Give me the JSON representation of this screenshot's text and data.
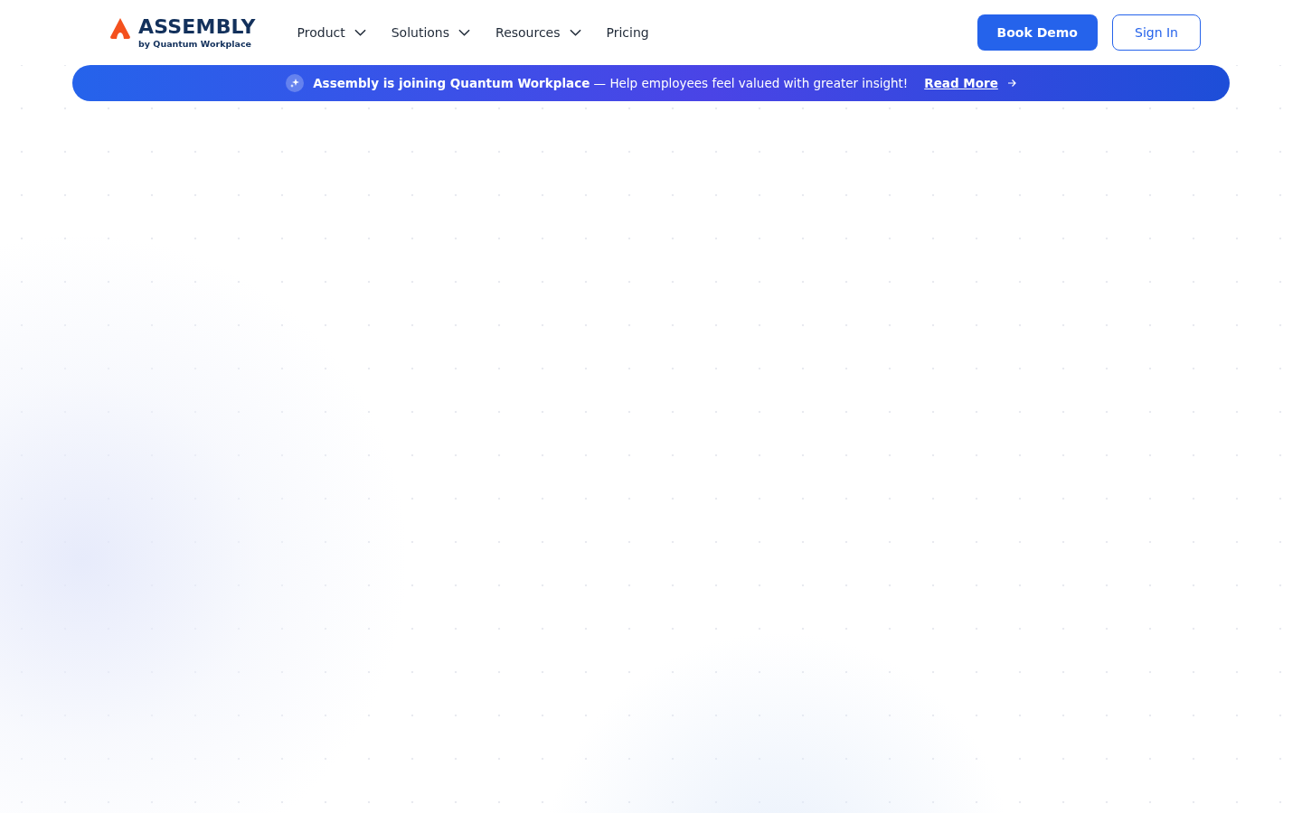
{
  "logo": {
    "name": "ASSEMBLY",
    "byline": "by Quantum Workplace"
  },
  "nav": [
    {
      "label": "Product",
      "has_menu": true
    },
    {
      "label": "Solutions",
      "has_menu": true
    },
    {
      "label": "Resources",
      "has_menu": true
    },
    {
      "label": "Pricing",
      "has_menu": false
    }
  ],
  "actions": {
    "primary": "Book Demo",
    "secondary": "Sign In"
  },
  "banner": {
    "message": "**Assembly is joining Quantum Workplace** — Help employees feel valued with greater insight!",
    "link": "Read More"
  }
}
